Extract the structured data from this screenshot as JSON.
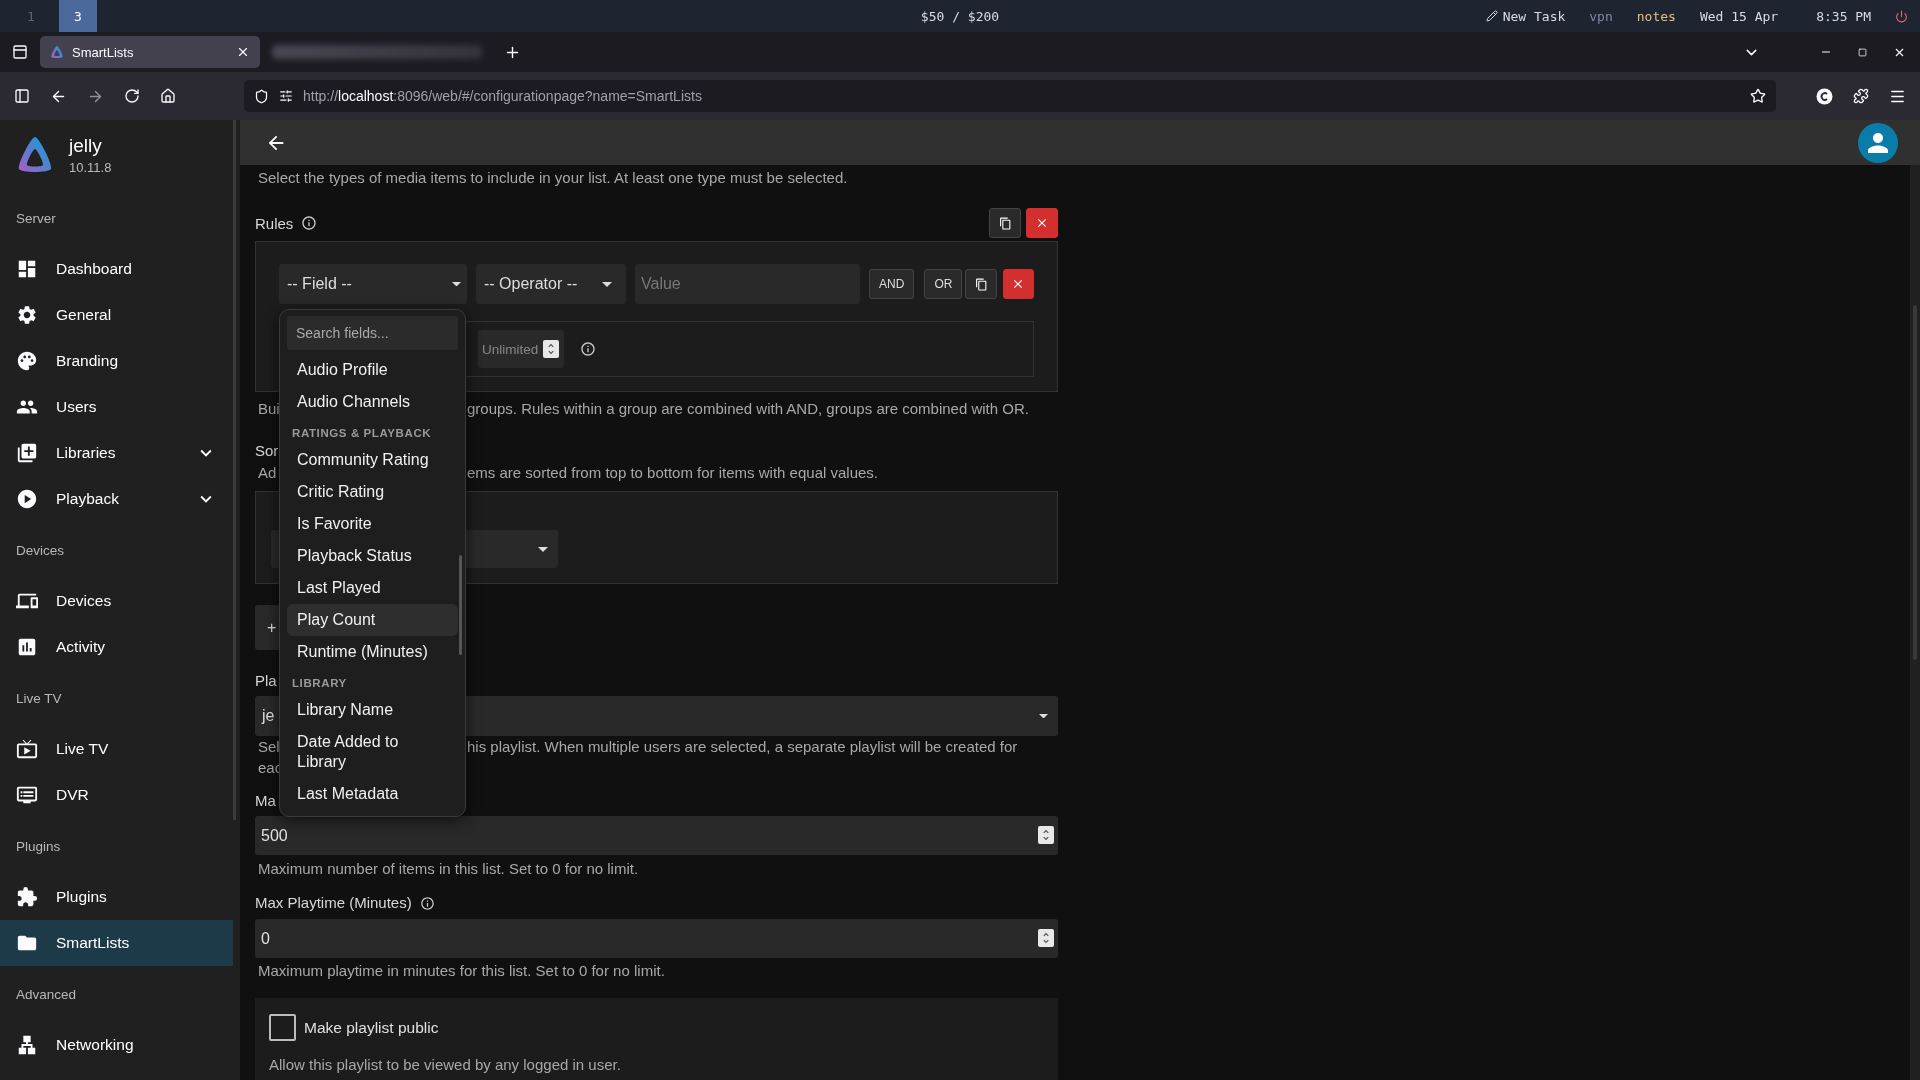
{
  "topbar": {
    "workspaces": [
      {
        "label": "1",
        "selected": false
      },
      {
        "label": "3",
        "selected": true
      }
    ],
    "budget": "$50 / $200",
    "new_task": "New Task",
    "indicators": [
      {
        "label": "vpn",
        "kind": "muted"
      },
      {
        "label": "notes",
        "kind": "highlight"
      }
    ],
    "date": "Wed 15 Apr",
    "time": "8:35 PM"
  },
  "browser": {
    "tabs": [
      {
        "title": "SmartLists",
        "selected": true
      }
    ],
    "url": {
      "scheme": "http://",
      "host": "localhost",
      "path": ":8096/web/#/configurationpage?name=SmartLists"
    }
  },
  "sidebar": {
    "app_name": "jelly",
    "version": "10.11.8",
    "sections": [
      {
        "heading": "Server",
        "items": [
          {
            "label": "Dashboard",
            "kind": "link",
            "selected": false
          },
          {
            "label": "General",
            "kind": "link",
            "selected": false
          },
          {
            "label": "Branding",
            "kind": "link",
            "selected": false
          },
          {
            "label": "Users",
            "kind": "link",
            "selected": false
          },
          {
            "label": "Libraries",
            "kind": "group",
            "expanded": false,
            "selected": false
          },
          {
            "label": "Playback",
            "kind": "group",
            "expanded": false,
            "selected": false
          }
        ]
      },
      {
        "heading": "Devices",
        "items": [
          {
            "label": "Devices",
            "kind": "link",
            "selected": false
          },
          {
            "label": "Activity",
            "kind": "link",
            "selected": false
          }
        ]
      },
      {
        "heading": "Live TV",
        "items": [
          {
            "label": "Live TV",
            "kind": "link",
            "selected": false
          },
          {
            "label": "DVR",
            "kind": "link",
            "selected": false
          }
        ]
      },
      {
        "heading": "Plugins",
        "items": [
          {
            "label": "Plugins",
            "kind": "link",
            "selected": false
          },
          {
            "label": "SmartLists",
            "kind": "link",
            "selected": true
          }
        ]
      },
      {
        "heading": "Advanced",
        "items": [
          {
            "label": "Networking",
            "kind": "link",
            "selected": false
          }
        ]
      }
    ]
  },
  "intro": "Select the types of media items to include in your list. At least one type must be selected.",
  "rules": {
    "label": "Rules",
    "field_placeholder": "-- Field --",
    "operator_placeholder": "-- Operator --",
    "value_placeholder": "Value",
    "joiners": [
      "AND",
      "OR"
    ],
    "limit_placeholder": "Unlimited",
    "help_left": "Bui",
    "help_right": "groups. Rules within a group are combined with AND, groups are combined with OR."
  },
  "sort": {
    "label_left": "Sor",
    "help_left": "Ad",
    "help_right": "ems are sorted from top to bottom for items with equal values.",
    "add_button": "+"
  },
  "playlist_user": {
    "label_left": "Pla",
    "value": "je",
    "help_lines": [
      {
        "left": "Sel",
        "right": "his playlist. When multiple users are selected, a separate playlist will be created for"
      },
      {
        "left": "eac"
      }
    ]
  },
  "max_items": {
    "label": "Ma",
    "value": "500",
    "help": "Maximum number of items in this list. Set to 0 for no limit."
  },
  "max_playtime": {
    "label": "Max Playtime (Minutes)",
    "value": "0",
    "help": "Maximum playtime in minutes for this list. Set to 0 for no limit."
  },
  "public": {
    "label": "Make playlist public",
    "checked": false,
    "help": "Allow this playlist to be viewed by any logged in user."
  },
  "field_menu": {
    "search_placeholder": "Search fields...",
    "entries": [
      {
        "kind": "item",
        "label": "Audio Profile",
        "selected": false
      },
      {
        "kind": "item",
        "label": "Audio Channels",
        "selected": false
      },
      {
        "kind": "header",
        "label": "RATINGS & PLAYBACK"
      },
      {
        "kind": "item",
        "label": "Community Rating",
        "selected": false
      },
      {
        "kind": "item",
        "label": "Critic Rating",
        "selected": false
      },
      {
        "kind": "item",
        "label": "Is Favorite",
        "selected": false
      },
      {
        "kind": "item",
        "label": "Playback Status",
        "selected": false
      },
      {
        "kind": "item",
        "label": "Last Played",
        "selected": false
      },
      {
        "kind": "item",
        "label": "Play Count",
        "selected": true
      },
      {
        "kind": "item",
        "label": "Runtime (Minutes)",
        "selected": false
      },
      {
        "kind": "header",
        "label": "LIBRARY"
      },
      {
        "kind": "item",
        "label": "Library Name",
        "selected": false
      },
      {
        "kind": "item",
        "label": "Date Added to Library",
        "selected": false
      },
      {
        "kind": "item",
        "label": "Last Metadata",
        "selected": false
      }
    ]
  }
}
